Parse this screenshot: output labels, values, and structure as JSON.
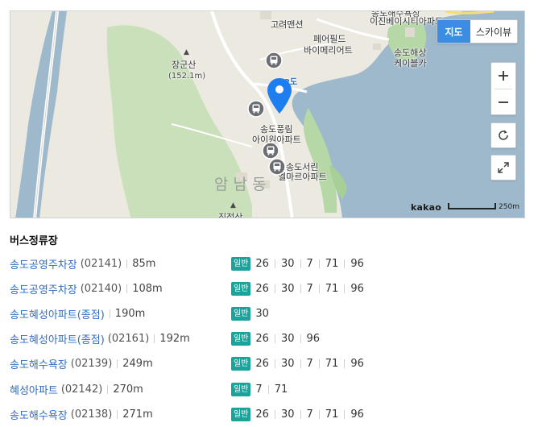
{
  "map": {
    "maptype": {
      "map_label": "지도",
      "skyview_label": "스카이뷰",
      "active": "map"
    },
    "labels": {
      "goryeo": "고려맨션",
      "eejin_top": "송도해수욕장",
      "eejin": "이진베이시티아파트",
      "payfield_1": "페어필드",
      "payfield_2": "바이메리어트",
      "cablecar_1": "송도해상",
      "cablecar_2": "케이블카",
      "janggunsan": "장군산",
      "janggunsan_height": "(152.1m)",
      "pungnim_1": "송도풍림",
      "pungnim_2": "아이원아파트",
      "seorin_1": "송도서린",
      "seorin_2": "엘마르아파트",
      "amnamdong": "암남동",
      "jinjeongsan": "진정산",
      "route_badge": "2도"
    },
    "scale": {
      "logo": "kakao",
      "distance": "250m"
    },
    "colors": {
      "land": "#ece9e1",
      "sea": "#9fb9cc",
      "green": "#b6d7a6",
      "road": "#ffffff",
      "marker": "#1e7ef0"
    }
  },
  "bus": {
    "title": "버스정류장",
    "stops": [
      {
        "name": "송도공영주차장",
        "code": "(02141)",
        "distance": "85m",
        "type": "일반",
        "routes": [
          "26",
          "30",
          "7",
          "71",
          "96"
        ]
      },
      {
        "name": "송도공영주차장",
        "code": "(02140)",
        "distance": "108m",
        "type": "일반",
        "routes": [
          "26",
          "30",
          "7",
          "71",
          "96"
        ]
      },
      {
        "name": "송도혜성아파트(종점)",
        "code": "",
        "distance": "190m",
        "type": "일반",
        "routes": [
          "30"
        ]
      },
      {
        "name": "송도혜성아파트(종점)",
        "code": "(02161)",
        "distance": "192m",
        "type": "일반",
        "routes": [
          "26",
          "30",
          "96"
        ]
      },
      {
        "name": "송도해수욕장",
        "code": "(02139)",
        "distance": "249m",
        "type": "일반",
        "routes": [
          "26",
          "30",
          "7",
          "71",
          "96"
        ]
      },
      {
        "name": "혜성아파트",
        "code": "(02142)",
        "distance": "270m",
        "type": "일반",
        "routes": [
          "7",
          "71"
        ]
      },
      {
        "name": "송도해수욕장",
        "code": "(02138)",
        "distance": "271m",
        "type": "일반",
        "routes": [
          "26",
          "30",
          "7",
          "71",
          "96"
        ]
      }
    ]
  }
}
